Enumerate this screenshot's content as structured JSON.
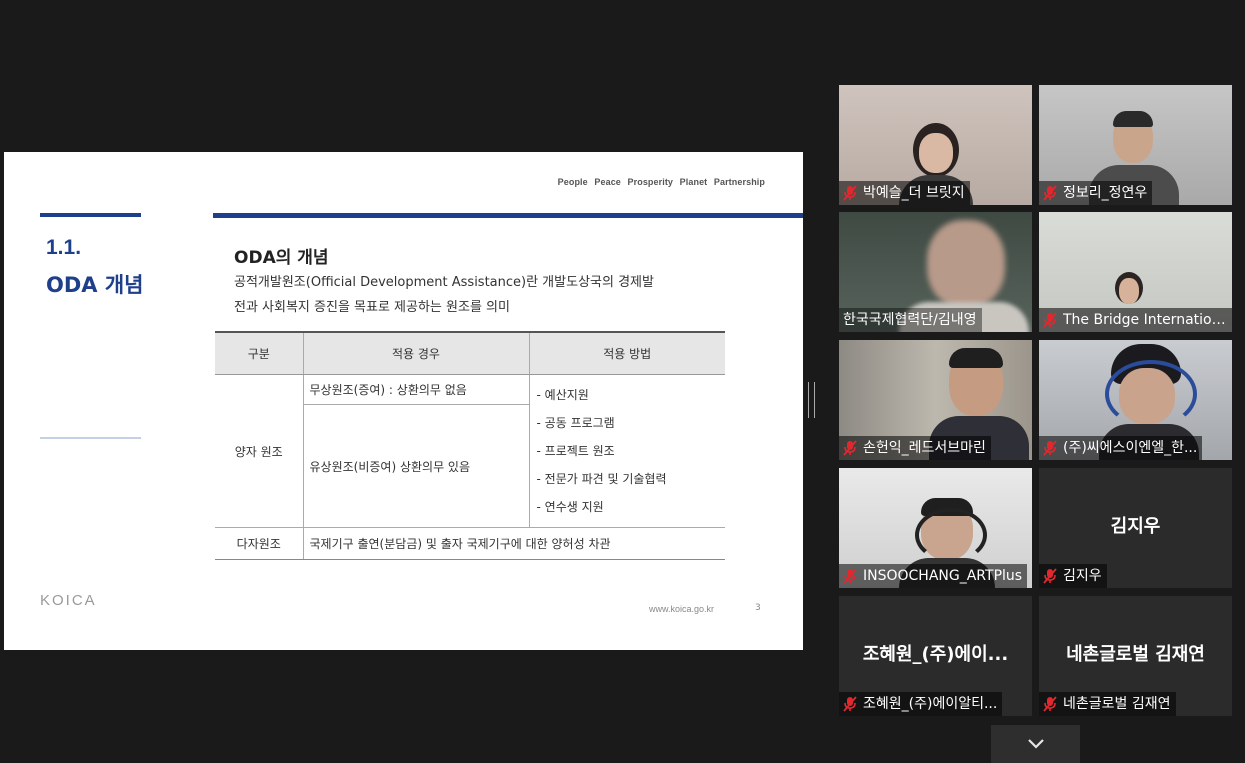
{
  "slide": {
    "tagline": [
      "People",
      "Peace",
      "Prosperity",
      "Planet",
      "Partnership"
    ],
    "section_number": "1.1.",
    "section_title": "ODA 개념",
    "heading": "ODA의 개념",
    "description": "공적개발원조(Official Development Assistance)란 개발도상국의 경제발전과 사회복지 증진을 목표로 제공하는 원조를 의미",
    "table": {
      "headers": [
        "구분",
        "적용 경우",
        "적용 방법"
      ],
      "bilateral_label": "양자 원조",
      "bilateral_grant": "무상원조(증여) : 상환의무 없음",
      "bilateral_loan": "유상원조(비증여) 상환의무 있음",
      "methods": [
        "예산지원",
        "공동 프로그램",
        "프로젝트 원조",
        "전문가 파견 및 기술협력",
        "연수생 지원"
      ],
      "multilateral_label": "다자원조",
      "multilateral_desc": "국제기구 출연(분담금) 및 출자 국제기구에 대한 양허성 차관"
    },
    "logo_text": "KOICA",
    "url": "www.koica.go.kr",
    "page_number": "3"
  },
  "participants": [
    {
      "name": "박예슬_더 브릿지",
      "muted": true
    },
    {
      "name": "정보리_정연우",
      "muted": true
    },
    {
      "name": "한국국제협력단/김내영",
      "muted": false,
      "active": true
    },
    {
      "name": "The Bridge International",
      "muted": true
    },
    {
      "name": "손헌익_레드서브마린",
      "muted": true
    },
    {
      "name": "(주)씨에스이엔엘_한...",
      "muted": true
    },
    {
      "name": "INSOOCHANG_ARTPlus",
      "muted": true
    },
    {
      "name": "김지우",
      "muted": true,
      "center_name": "김지우"
    },
    {
      "name": "조혜원_(주)에이알티...",
      "muted": true,
      "center_name": "조혜원_(주)에이..."
    },
    {
      "name": "네촌글로벌 김재연",
      "muted": true,
      "center_name": "네촌글로벌 김재연"
    }
  ],
  "colors": {
    "slide_accent": "#1e3f8a",
    "active_speaker_border": "#d3e035",
    "muted_icon": "#e0282e"
  },
  "icons": {
    "muted": "mic-off-icon",
    "scroll": "chevron-down-icon"
  }
}
